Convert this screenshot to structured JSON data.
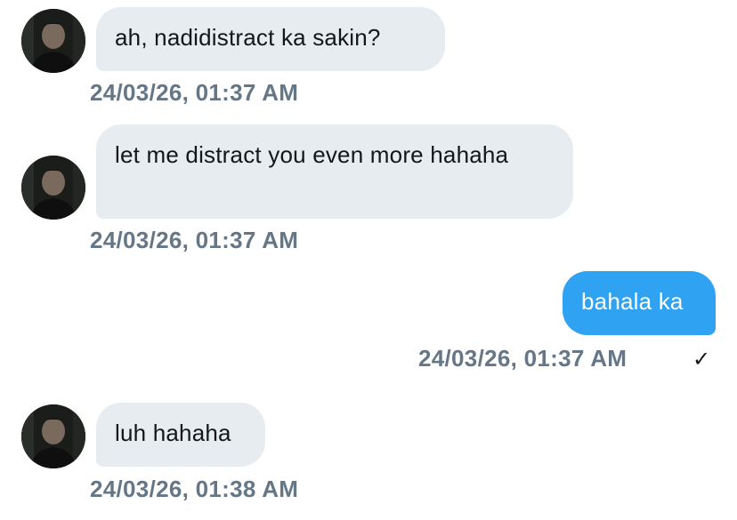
{
  "messages": [
    {
      "direction": "incoming",
      "text": "ah, nadidistract ka sakin?",
      "timestamp": "24/03/26, 01:37 AM"
    },
    {
      "direction": "incoming",
      "text": "let me distract you even more hahaha",
      "timestamp": "24/03/26, 01:37 AM"
    },
    {
      "direction": "outgoing",
      "text": "bahala ka",
      "timestamp": "24/03/26, 01:37 AM",
      "status": "✓"
    },
    {
      "direction": "incoming",
      "text": "luh hahaha",
      "timestamp": "24/03/26, 01:38 AM"
    }
  ],
  "colors": {
    "incoming_bubble": "#e6ecf0",
    "outgoing_bubble": "#2fa2f2",
    "timestamp": "#657786",
    "text": "#14171a"
  },
  "icons": {
    "avatar": "user-photo-avatar",
    "read_receipt": "check-icon"
  }
}
